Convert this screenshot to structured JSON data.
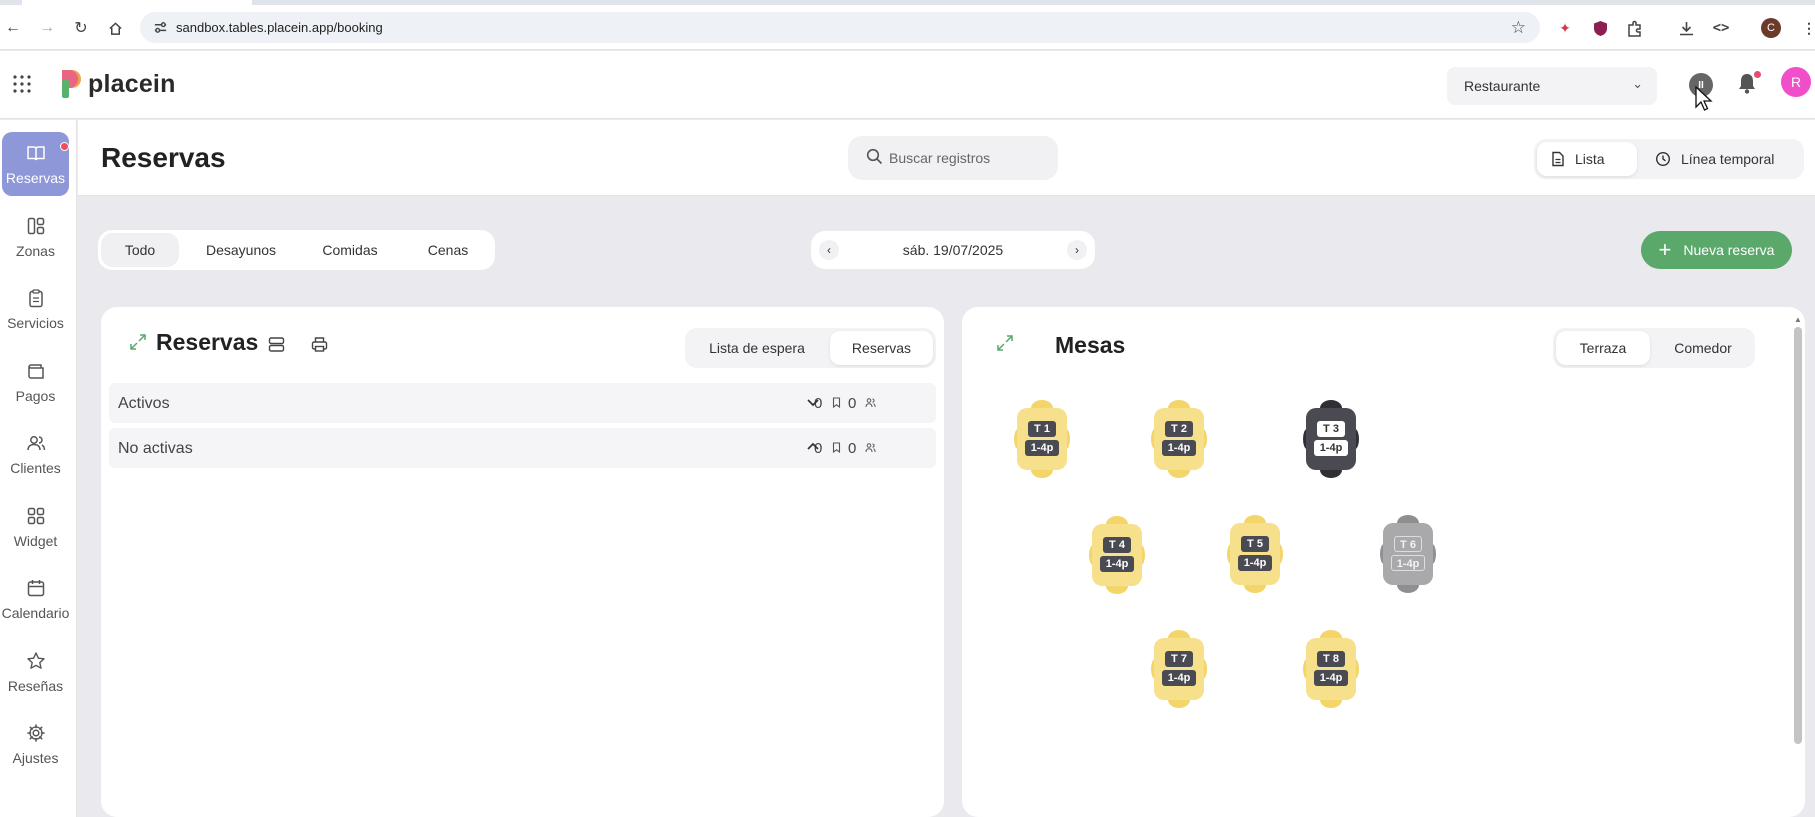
{
  "browser": {
    "url": "sandbox.tables.placein.app/booking",
    "profile_initial": "C"
  },
  "header": {
    "logo_text": "placein",
    "restaurant_select": "Restaurante",
    "avatar_initial": "R",
    "pause_glyph": "II"
  },
  "sidebar": {
    "items": [
      {
        "label": "Reservas",
        "icon": "book-open-icon"
      },
      {
        "label": "Zonas",
        "icon": "layout-icon"
      },
      {
        "label": "Servicios",
        "icon": "clipboard-icon"
      },
      {
        "label": "Pagos",
        "icon": "wallet-icon"
      },
      {
        "label": "Clientes",
        "icon": "users-icon"
      },
      {
        "label": "Widget",
        "icon": "grid-icon"
      },
      {
        "label": "Calendario",
        "icon": "calendar-icon"
      },
      {
        "label": "Reseñas",
        "icon": "star-icon"
      },
      {
        "label": "Ajustes",
        "icon": "gear-icon"
      }
    ]
  },
  "page": {
    "title": "Reservas",
    "search_placeholder": "Buscar registros",
    "view_list": "Lista",
    "view_timeline": "Línea temporal"
  },
  "filters": [
    "Todo",
    "Desayunos",
    "Comidas",
    "Cenas"
  ],
  "date": "sáb. 19/07/2025",
  "new_button": "Nueva reserva",
  "reservations_panel": {
    "title": "Reservas",
    "tab_waitlist": "Lista de espera",
    "tab_reservations": "Reservas",
    "groups": [
      {
        "label": "Activos",
        "bookings": "0",
        "people": "0"
      },
      {
        "label": "No activas",
        "bookings": "0",
        "people": "0"
      }
    ]
  },
  "tables_panel": {
    "title": "Mesas",
    "zone_terraza": "Terraza",
    "zone_comedor": "Comedor",
    "tables": [
      {
        "name": "T 1",
        "capacity": "1-4p",
        "state": "available"
      },
      {
        "name": "T 2",
        "capacity": "1-4p",
        "state": "available"
      },
      {
        "name": "T 3",
        "capacity": "1-4p",
        "state": "occupied"
      },
      {
        "name": "T 4",
        "capacity": "1-4p",
        "state": "available"
      },
      {
        "name": "T 5",
        "capacity": "1-4p",
        "state": "available"
      },
      {
        "name": "T 6",
        "capacity": "1-4p",
        "state": "disabled"
      },
      {
        "name": "T 7",
        "capacity": "1-4p",
        "state": "available"
      },
      {
        "name": "T 8",
        "capacity": "1-4p",
        "state": "available"
      }
    ]
  },
  "colors": {
    "accent": "#8e97d8",
    "new_button": "#5aa96b",
    "table_available": "#f7e08c",
    "table_occupied": "#4a4a52",
    "table_disabled": "#a9a9ab",
    "avatar": "#f04fc9"
  }
}
